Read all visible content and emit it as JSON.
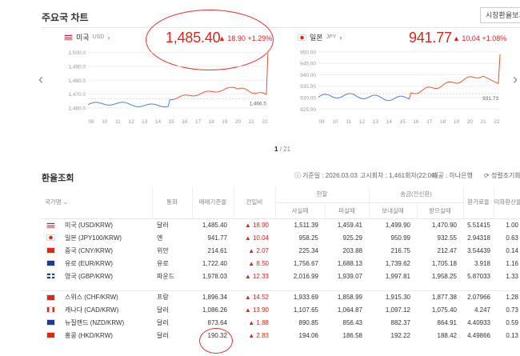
{
  "section_title": "주요국 차트",
  "all_rates_button": "시장환율보기",
  "cards": [
    {
      "name": "미국",
      "code": "USD",
      "value": "1,485.40",
      "change": "▲ 18.90",
      "change_pct": "+1.29%",
      "y_ticks": [
        "1,500.0",
        "1,490.0",
        "1,480.0",
        "1,470.0",
        "1,460.0"
      ],
      "y_min": 1456,
      "y_max": 1502,
      "baseline": 1466.5,
      "baseline_label": "1,466.5",
      "x_ticks": [
        "09",
        "10",
        "11",
        "12",
        "13",
        "14",
        "15",
        "16",
        "17",
        "18",
        "19",
        "20",
        "21",
        "22"
      ]
    },
    {
      "name": "일본",
      "code": "JPY",
      "value": "941.77",
      "change": "▲ 10.04",
      "change_pct": "+1.08%",
      "y_ticks": [
        "950.00",
        "945.00",
        "940.00",
        "935.00",
        "930.00",
        "925.00"
      ],
      "y_min": 923,
      "y_max": 951,
      "baseline": 931.73,
      "baseline_label": "931.73",
      "x_ticks": [
        "09",
        "10",
        "11",
        "12",
        "13",
        "14",
        "15",
        "16",
        "17",
        "18",
        "19",
        "20",
        "21",
        "22"
      ]
    }
  ],
  "pager": {
    "current": "1",
    "total": "/ 21"
  },
  "table_title": "환율조회",
  "info": {
    "date_label": "기준일 : 2026.03.03",
    "notice": "고시회차 : 1,461회차(22:06)",
    "source": "제공 : 하나은행",
    "refresh": "정렬조기화"
  },
  "headers": {
    "country": "국가명",
    "unit": "통화",
    "base": "매매기준율",
    "prev": "전일비",
    "cash": "현찰",
    "remit": "송금(전신환)",
    "cash_buy": "사실때",
    "cash_sell": "파실때",
    "send": "보내실때",
    "receive": "받으실때",
    "usd_rate": "환가료율",
    "usd_conv": "미화환산율"
  },
  "rows": [
    {
      "flag": "us",
      "name": "미국 (USD/KRW)",
      "unit": "달러",
      "base": "1,485.40",
      "prev": "▲ 18.90",
      "cash_buy": "1,511.39",
      "cash_sell": "1,459.41",
      "send": "1,499.90",
      "receive": "1,470.90",
      "fee": "5.51415",
      "conv": "1.00"
    },
    {
      "flag": "jp",
      "name": "일본 (JPY100/KRW)",
      "unit": "엔",
      "base": "941.77",
      "prev": "▲ 10.04",
      "cash_buy": "958.25",
      "cash_sell": "925.29",
      "send": "950.99",
      "receive": "932.55",
      "fee": "2.94318",
      "conv": "0.63"
    },
    {
      "flag": "cn",
      "name": "중국 (CNY/KRW)",
      "unit": "위안",
      "base": "214.61",
      "prev": "▲ 2.07",
      "cash_buy": "225.34",
      "cash_sell": "203.88",
      "send": "216.75",
      "receive": "212.47",
      "fee": "3.54439",
      "conv": "0.14"
    },
    {
      "flag": "eu",
      "name": "유로 (EUR/KRW)",
      "unit": "유로",
      "base": "1,722.40",
      "prev": "▲ 8.50",
      "cash_buy": "1,756.67",
      "cash_sell": "1,688.13",
      "send": "1,739.62",
      "receive": "1,705.18",
      "fee": "3.918",
      "conv": "1.16"
    },
    {
      "flag": "gb",
      "name": "영국 (GBP/KRW)",
      "unit": "파운드",
      "base": "1,978.03",
      "prev": "▲ 12.33",
      "cash_buy": "2,016.99",
      "cash_sell": "1,939.07",
      "send": "1,997.81",
      "receive": "1,958.25",
      "fee": "5.87033",
      "conv": "1.33"
    }
  ],
  "rows2": [
    {
      "flag": "ch",
      "name": "스위스 (CHF/KRW)",
      "unit": "프랑",
      "base": "1,896.34",
      "prev": "▲ 14.52",
      "cash_buy": "1,933.69",
      "cash_sell": "1,858.99",
      "send": "1,915.30",
      "receive": "1,877.38",
      "fee": "2.07966",
      "conv": "1.28"
    },
    {
      "flag": "ca",
      "name": "캐나다 (CAD/KRW)",
      "unit": "달러",
      "base": "1,086.26",
      "prev": "▲ 13.90",
      "cash_buy": "1,107.65",
      "cash_sell": "1,064.87",
      "send": "1,097.12",
      "receive": "1,075.40",
      "fee": "4.247",
      "conv": "0.73"
    },
    {
      "flag": "nz",
      "name": "뉴질랜드 (NZD/KRW)",
      "unit": "달러",
      "base": "873.64",
      "prev": "▲ 1.88",
      "cash_buy": "890.85",
      "cash_sell": "856.43",
      "send": "882.37",
      "receive": "864.91",
      "fee": "4.40933",
      "conv": "0.59"
    },
    {
      "flag": "hk",
      "name": "홍콩 (HKD/KRW)",
      "unit": "달러",
      "base": "190.32",
      "prev": "▲ 2.83",
      "cash_buy": "194.06",
      "cash_sell": "186.58",
      "send": "192.22",
      "receive": "188.42",
      "fee": "4.49866",
      "conv": "0.13"
    }
  ],
  "colors": {
    "up": "#d9261c",
    "line_before": "#4a7fd0",
    "line_after": "#e3552f",
    "annotation": "#e53030"
  }
}
